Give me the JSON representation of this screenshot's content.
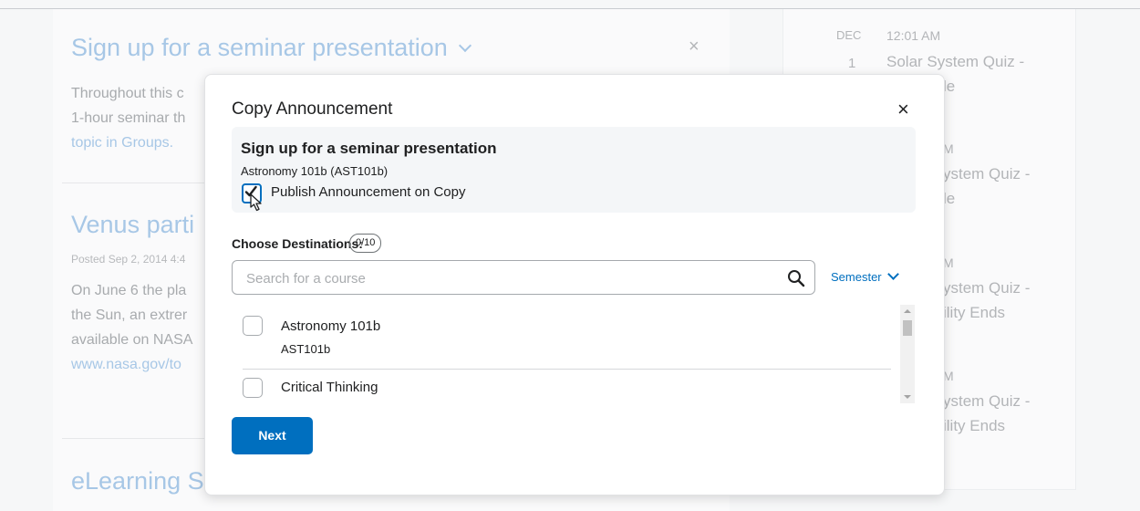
{
  "background": {
    "post1": {
      "title": "Sign up for a seminar presentation",
      "line1": "Throughout this c",
      "line2": "1-hour seminar th",
      "link": "topic in Groups."
    },
    "post2": {
      "title": "Venus parti",
      "meta": "Posted Sep 2, 2014 4:4",
      "line1": "On June 6 the pla",
      "line2": "the Sun, an extrer",
      "line3": "available on NASA",
      "link": "www.nasa.gov/to"
    },
    "post3": {
      "title": "eLearning S"
    },
    "close_glyph": "×",
    "sidebar": {
      "month": "DEC",
      "day": "1",
      "time": "12:01 AM",
      "event1_line1": "Solar System Quiz -",
      "event1_line2": "le",
      "event2_time": "M",
      "event2_line1": "ystem Quiz -",
      "event2_line2": "le",
      "event3_time": "M",
      "event3_line1": "ystem Quiz -",
      "event3_line2": "ility Ends",
      "event4_time": "M",
      "event4_line1": "ystem Quiz -",
      "event4_line2": "ility Ends"
    }
  },
  "dialog": {
    "title": "Copy Announcement",
    "close_glyph": "×",
    "announcement": {
      "title": "Sign up for a seminar presentation",
      "course": "Astronomy 101b (AST101b)",
      "publish_label": "Publish Announcement on Copy",
      "publish_checked": true
    },
    "destinations_label": "Choose Destinations:",
    "destinations_count": "0/10",
    "search_placeholder": "Search for a course",
    "filter_label": "Semester",
    "courses": [
      {
        "name": "Astronomy 101b",
        "code": "AST101b",
        "checked": false
      },
      {
        "name": "Critical Thinking",
        "code": "",
        "checked": false
      }
    ],
    "next_label": "Next"
  },
  "colors": {
    "accent": "#006fbf",
    "text": "#202122",
    "muted": "#a8abae"
  },
  "icons": [
    "close-icon",
    "search-icon",
    "chevron-down-icon",
    "checkmark-icon",
    "cursor-icon"
  ]
}
